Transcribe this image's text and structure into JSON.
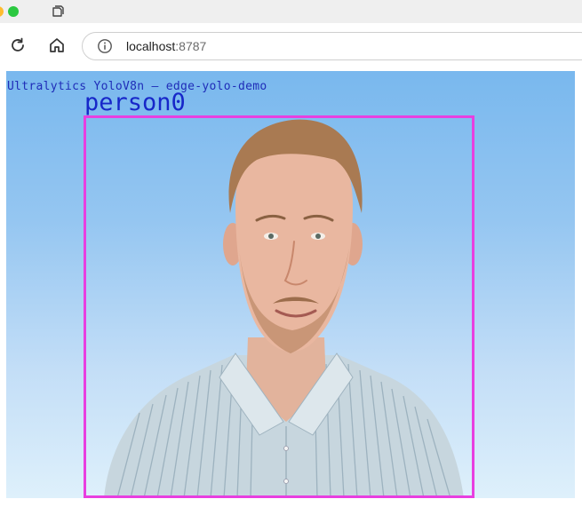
{
  "browser": {
    "url_host": "localhost",
    "url_port": ":8787"
  },
  "detection": {
    "title": "Ultralytics YoloV8n — edge-yolo-demo",
    "box_label": "person0",
    "box_color": "#e83fe0",
    "label_color": "#1727c9"
  },
  "icons": {
    "reload": "reload-icon",
    "home": "home-icon",
    "info": "info-icon",
    "tab": "tab-icon"
  }
}
